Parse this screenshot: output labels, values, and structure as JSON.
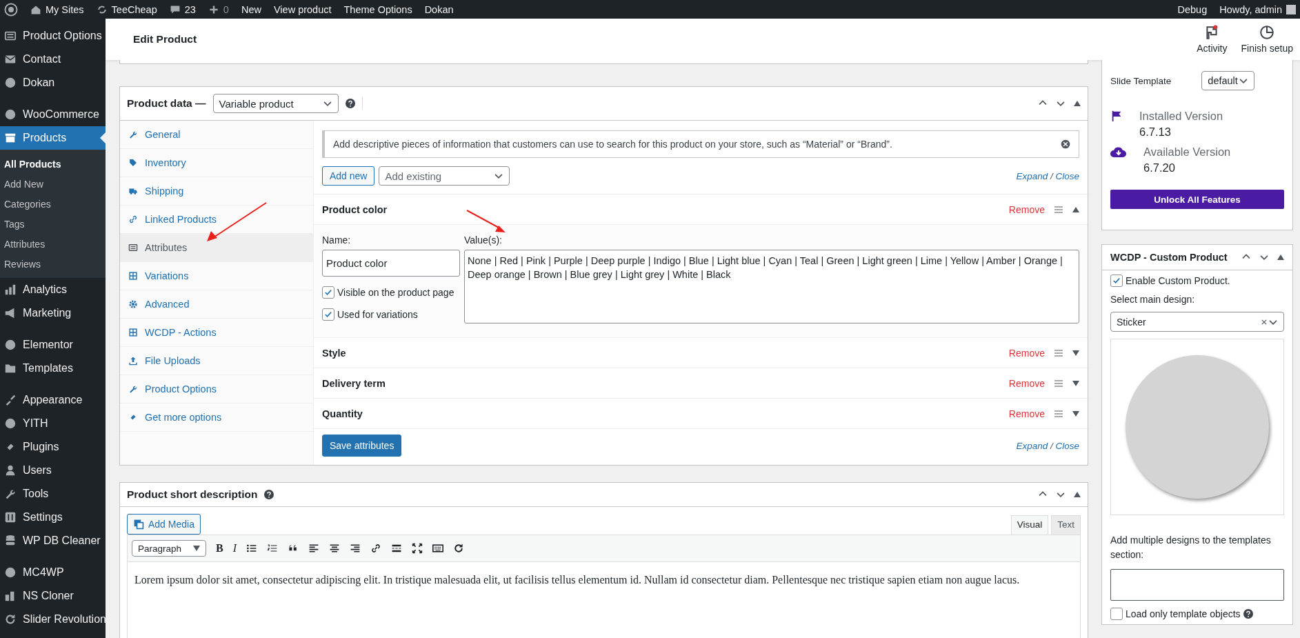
{
  "admin_bar": {
    "left": [
      {
        "label": "My Sites"
      },
      {
        "label": "TeeCheap"
      },
      {
        "label": "23"
      },
      {
        "label": "0"
      },
      {
        "label": "New"
      },
      {
        "label": "View product"
      },
      {
        "label": "Theme Options"
      },
      {
        "label": "Dokan"
      }
    ],
    "right": [
      {
        "label": "Debug"
      },
      {
        "label": "Howdy, admin"
      }
    ]
  },
  "sidebar": {
    "groups": [
      [
        {
          "label": "Product Options",
          "selected": false
        },
        {
          "label": "Contact",
          "selected": false
        },
        {
          "label": "Dokan",
          "selected": false
        }
      ],
      [
        {
          "label": "WooCommerce",
          "selected": false
        },
        {
          "label": "Products",
          "selected": true,
          "children": [
            {
              "label": "All Products",
              "selected": true
            },
            {
              "label": "Add New",
              "selected": false
            },
            {
              "label": "Categories",
              "selected": false
            },
            {
              "label": "Tags",
              "selected": false
            },
            {
              "label": "Attributes",
              "selected": false
            },
            {
              "label": "Reviews",
              "selected": false
            }
          ]
        },
        {
          "label": "Analytics",
          "selected": false
        },
        {
          "label": "Marketing",
          "selected": false
        }
      ],
      [
        {
          "label": "Elementor",
          "selected": false
        },
        {
          "label": "Templates",
          "selected": false
        }
      ],
      [
        {
          "label": "Appearance",
          "selected": false
        },
        {
          "label": "YITH",
          "selected": false
        },
        {
          "label": "Plugins",
          "selected": false
        },
        {
          "label": "Users",
          "selected": false
        },
        {
          "label": "Tools",
          "selected": false
        },
        {
          "label": "Settings",
          "selected": false
        },
        {
          "label": "WP DB Cleaner",
          "selected": false
        }
      ],
      [
        {
          "label": "MC4WP",
          "selected": false
        },
        {
          "label": "NS Cloner",
          "selected": false
        },
        {
          "label": "Slider Revolution",
          "selected": false
        }
      ]
    ]
  },
  "header": {
    "title": "Edit Product",
    "actions": [
      {
        "label": "Activity",
        "notification": true
      },
      {
        "label": "Finish setup",
        "notification": false
      }
    ]
  },
  "product_data": {
    "title": "Product data —",
    "type_select": "Variable product",
    "tabs": [
      {
        "label": "General",
        "selected": false
      },
      {
        "label": "Inventory",
        "selected": false
      },
      {
        "label": "Shipping",
        "selected": false
      },
      {
        "label": "Linked Products",
        "selected": false
      },
      {
        "label": "Attributes",
        "selected": true
      },
      {
        "label": "Variations",
        "selected": false
      },
      {
        "label": "Advanced",
        "selected": false
      },
      {
        "label": "WCDP - Actions",
        "selected": false
      },
      {
        "label": "File Uploads",
        "selected": false
      },
      {
        "label": "Product Options",
        "selected": false
      },
      {
        "label": "Get more options",
        "selected": false
      }
    ],
    "notice": "Add descriptive pieces of information that customers can use to search for this product on your store, such as “Material” or “Brand”.",
    "add_new": "Add new",
    "add_existing_placeholder": "Add existing",
    "expand": "Expand",
    "separator": "/",
    "close": "Close",
    "attributes": [
      {
        "name": "Product color",
        "expanded": true,
        "remove": "Remove",
        "name_label": "Name:",
        "name_value": "Product color",
        "values_label": "Value(s):",
        "values": "None | Red | Pink | Purple | Deep purple | Indigo | Blue | Light blue | Cyan | Teal | Green | Light green | Lime | Yellow | Amber | Orange | Deep orange | Brown | Blue grey | Light grey | White | Black",
        "options": [
          {
            "label": "Visible on the product page",
            "checked": true
          },
          {
            "label": "Used for variations",
            "checked": true
          }
        ]
      },
      {
        "name": "Style",
        "expanded": false,
        "remove": "Remove"
      },
      {
        "name": "Delivery term",
        "expanded": false,
        "remove": "Remove"
      },
      {
        "name": "Quantity",
        "expanded": false,
        "remove": "Remove"
      }
    ],
    "save": "Save attributes",
    "footer_expand": "Expand",
    "footer_separator": "/",
    "footer_close": "Close"
  },
  "short_description": {
    "title": "Product short description",
    "add_media": "Add Media",
    "editor_tabs": [
      {
        "label": "Visual",
        "selected": true
      },
      {
        "label": "Text",
        "selected": false
      }
    ],
    "format": "Paragraph",
    "glyphs": [
      "B",
      "I"
    ],
    "content": "Lorem ipsum dolor sit amet, consectetur adipiscing elit. In tristique malesuada elit, ut facilisis tellus elementum id. Nullam id consectetur diam. Pellentesque nec tristique sapien etiam non augue lacus."
  },
  "slider_box": {
    "slide_template_label": "Slide Template",
    "slide_template": "default",
    "installed_label": "Installed Version",
    "installed": "6.7.13",
    "available_label": "Available Version",
    "available": "6.7.20",
    "unlock": "Unlock All Features"
  },
  "wcdp_box": {
    "title": "WCDP - Custom Product",
    "enable": {
      "label": "Enable Custom Product.",
      "checked": true
    },
    "design_label": "Select main design:",
    "design": "Sticker",
    "multiple_label": "Add multiple designs to the templates section:",
    "load_only": {
      "label": "Load only template objects",
      "checked": false
    }
  }
}
